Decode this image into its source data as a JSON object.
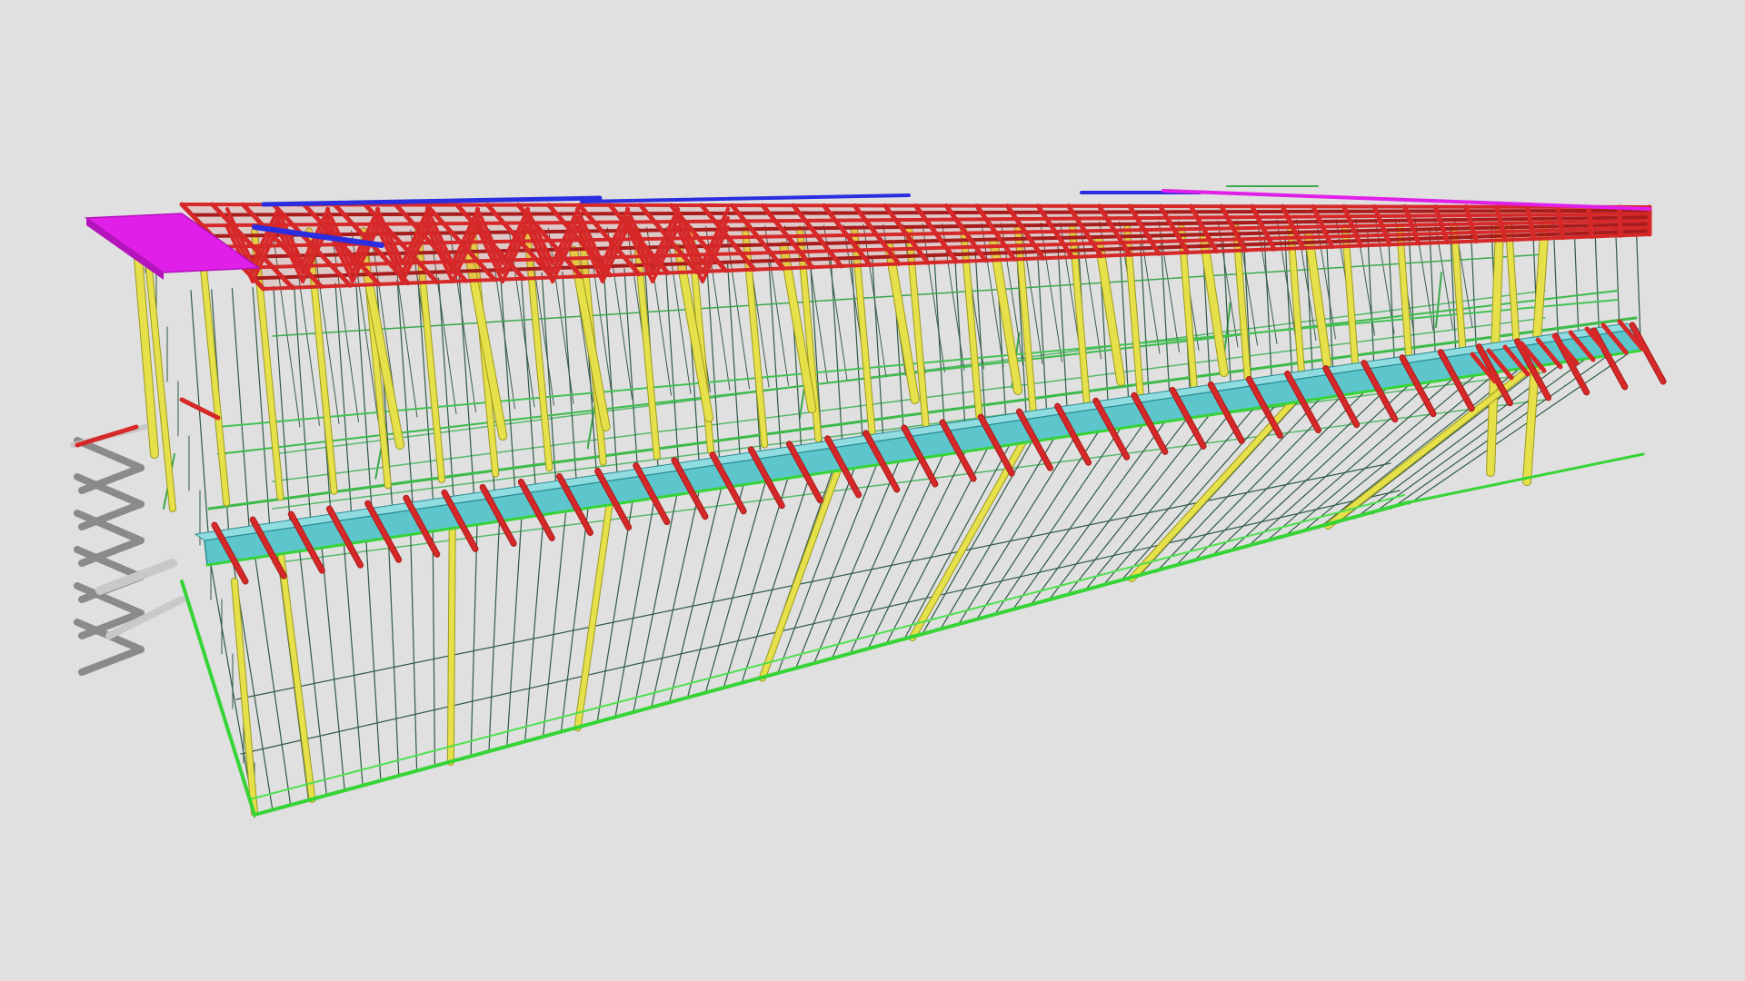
{
  "viewer": {
    "background": "#e0e0e0"
  },
  "model": {
    "palette": {
      "truss": "#d62828",
      "truss_dark": "#a81c1c",
      "truss_blue": "#2a2ee0",
      "deck_magenta": "#e020e8",
      "column": "#e6e04a",
      "column_edge": "#9c9a1e",
      "girt": "#2f5a46",
      "base_rail": "#36d436",
      "beam_cyan": "#5cc6cc",
      "beam_cyan_edge": "#2b8a90",
      "stair_grey": "#8a8a8a",
      "stair_light": "#c8c8c8"
    }
  }
}
